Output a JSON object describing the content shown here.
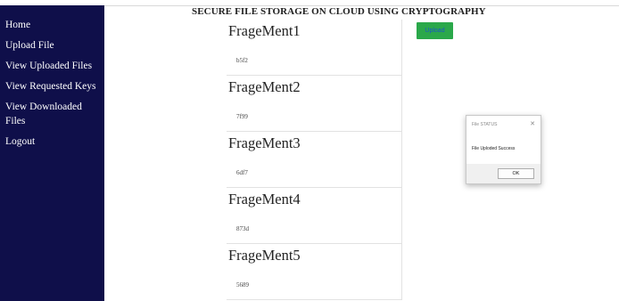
{
  "header": {
    "title": "SECURE FILE STORAGE ON CLOUD USING CRYPTOGRAPHY"
  },
  "sidebar": {
    "items": [
      {
        "label": "Home"
      },
      {
        "label": "Upload File"
      },
      {
        "label": "View Uploaded Files"
      },
      {
        "label": "View Requested Keys"
      },
      {
        "label": "View Downloaded Files"
      },
      {
        "label": "Logout"
      }
    ]
  },
  "fragments": [
    {
      "title": "FrageMent1",
      "value": "b5f2"
    },
    {
      "title": "FrageMent2",
      "value": "7f99"
    },
    {
      "title": "FrageMent3",
      "value": "6df7"
    },
    {
      "title": "FrageMent4",
      "value": "873d"
    },
    {
      "title": "FrageMent5",
      "value": "5689"
    }
  ],
  "upload_button": {
    "label": "Upload"
  },
  "dialog": {
    "title": "File STATUS",
    "close_glyph": "✕",
    "message": "File Uploded Success",
    "ok_label": "OK"
  },
  "colors": {
    "sidebar_bg": "#0f0f4a",
    "upload_button_bg": "#2aa84a"
  }
}
